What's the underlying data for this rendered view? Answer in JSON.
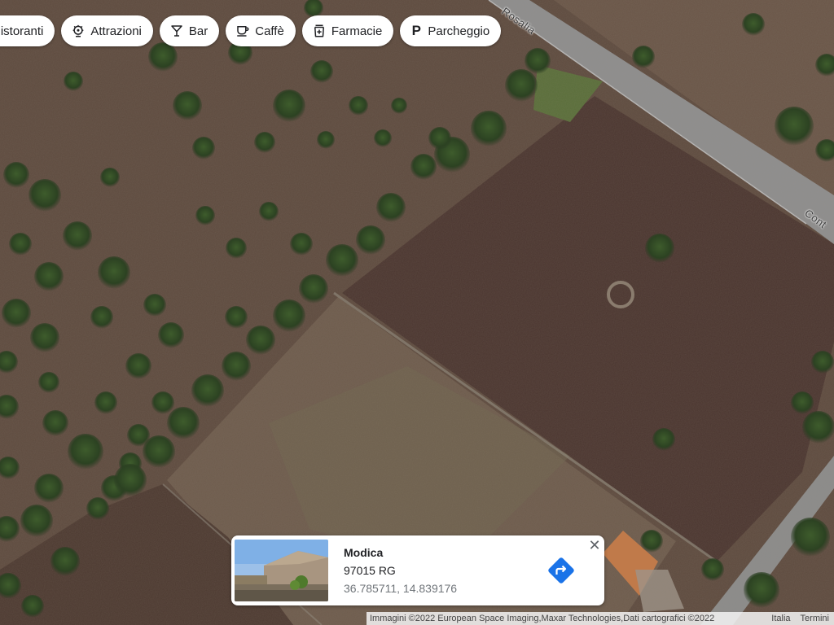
{
  "chips": [
    {
      "label": "Ristoranti",
      "icon": "restaurant-icon"
    },
    {
      "label": "Attrazioni",
      "icon": "attractions-icon"
    },
    {
      "label": "Bar",
      "icon": "cocktail-icon"
    },
    {
      "label": "Caffè",
      "icon": "coffee-icon"
    },
    {
      "label": "Farmacie",
      "icon": "pharmacy-icon"
    },
    {
      "label": "Parcheggio",
      "icon": "parking-icon"
    }
  ],
  "road_labels": {
    "top": "Rosalia",
    "right": "Cont"
  },
  "place_card": {
    "name": "Modica",
    "postal": "97015 RG",
    "coords": "36.785711, 14.839176",
    "directions_icon": "directions-icon",
    "close_icon": "close-icon"
  },
  "footer": {
    "attribution": "Immagini ©2022 European Space Imaging,Maxar Technologies,Dati cartografici ©2022",
    "country": "Italia",
    "terms": "Termini"
  },
  "colors": {
    "field_dark": "#4e3b33",
    "field_light": "#6b5a4c",
    "tree": "#2f4a24",
    "road": "#8c8c8c",
    "directions_blue": "#1a73e8"
  }
}
